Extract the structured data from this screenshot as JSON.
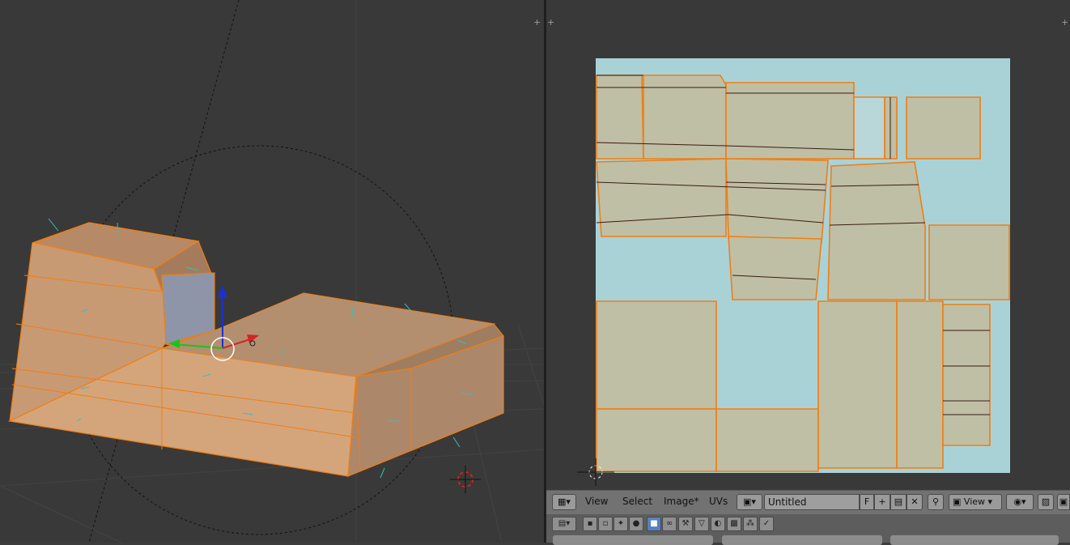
{
  "uv_editor": {
    "header": {
      "menus": [
        "View",
        "Select",
        "Image*",
        "UVs"
      ],
      "image_name": "Untitled",
      "fake_user_label": "F",
      "view_mode_label": "View"
    },
    "colors": {
      "uv_background": "#a9d2d7",
      "island_fill": "#bfbfa5",
      "uv_edge": "#f07e14",
      "selection_orange": "#f39a3e"
    }
  },
  "viewport": {
    "icons": [
      "3d-cursor-icon",
      "manipulator-icon",
      "lamp-icon"
    ]
  },
  "toolbar": {
    "icons": [
      "editor-type-icon",
      "object-mode-icon",
      "display-icon",
      "shading-icon",
      "solid-icon",
      "texture-icon",
      "link-icon",
      "wrench-icon",
      "pin-icon",
      "material-icon",
      "checker-icon",
      "snap-icon",
      "check-icon"
    ]
  }
}
